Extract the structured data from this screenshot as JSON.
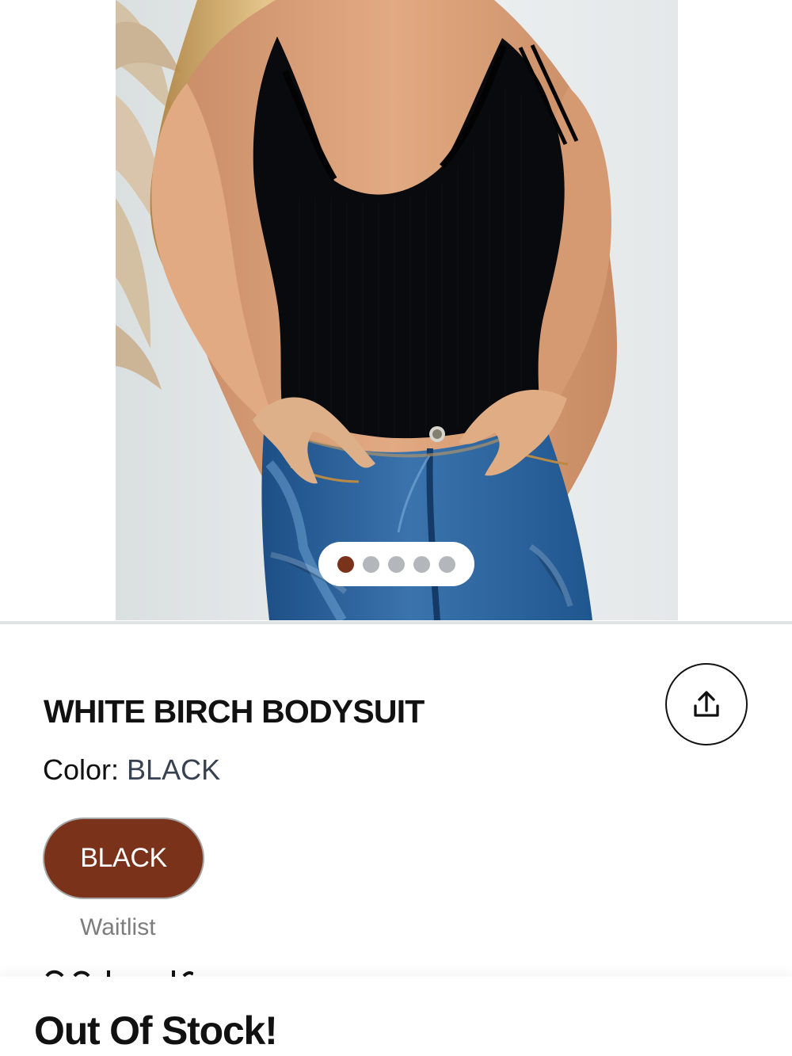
{
  "product": {
    "title": "WHITE BIRCH BODYSUIT",
    "gallery": {
      "active_image": 1,
      "image_count": 5,
      "image_subject": "model wearing a black v-neck bodysuit and blue jeans"
    }
  },
  "share": {
    "icon": "share-icon"
  },
  "color": {
    "label": "Color:",
    "selected_value": "BLACK",
    "swatch_label": "BLACK",
    "availability": "Waitlist",
    "accent_color": "#7a331a"
  },
  "stock": {
    "status": "Out Of Stock!"
  }
}
